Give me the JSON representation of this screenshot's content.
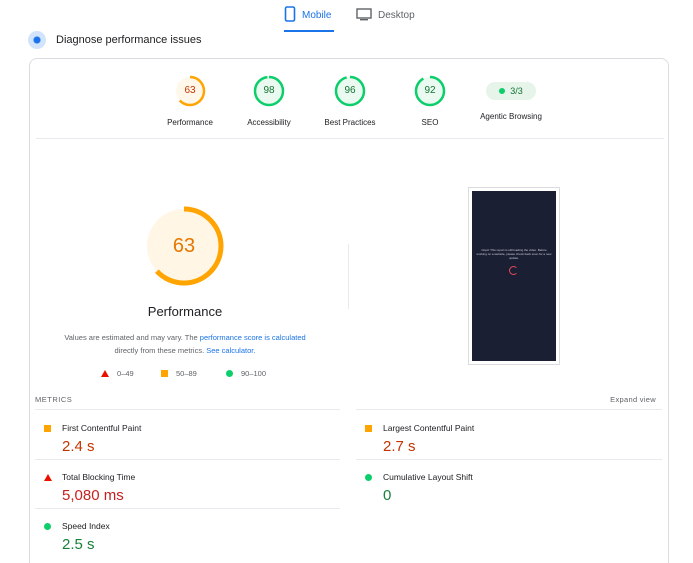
{
  "tabs": [
    {
      "label": "Mobile",
      "active": true
    },
    {
      "label": "Desktop",
      "active": false
    }
  ],
  "header": {
    "title": "Diagnose performance issues"
  },
  "categories": [
    {
      "score": "63",
      "label": "Performance",
      "color": "#ffa400",
      "fraction": 0.63
    },
    {
      "score": "98",
      "label": "Accessibility",
      "color": "#0cce6b",
      "fraction": 0.98
    },
    {
      "score": "96",
      "label": "Best Practices",
      "color": "#0cce6b",
      "fraction": 0.96
    },
    {
      "score": "92",
      "label": "SEO",
      "color": "#0cce6b",
      "fraction": 0.92
    },
    {
      "score": "3/3",
      "label": "Agentic Browsing",
      "pill": true
    }
  ],
  "big": {
    "score": "63",
    "fraction": 0.63,
    "title": "Performance",
    "note_prefix": "Values are estimated and may vary. The ",
    "note_link1": "performance score is calculated",
    "note_middle": "directly from these metrics. ",
    "note_link2": "See calculator."
  },
  "legend": {
    "low": "0–49",
    "mid": "50–89",
    "high": "90–100"
  },
  "screenshot_text": "Oops! This report is still loading the video. Before working on a website, please check back soon for a new update.",
  "metrics_label": "METRICS",
  "expand_label": "Expand view",
  "metrics": [
    {
      "name": "First Contentful Paint",
      "value": "2.4 s",
      "status": "average"
    },
    {
      "name": "Largest Contentful Paint",
      "value": "2.7 s",
      "status": "average"
    },
    {
      "name": "Total Blocking Time",
      "value": "5,080 ms",
      "status": "fail"
    },
    {
      "name": "Cumulative Layout Shift",
      "value": "0",
      "status": "pass"
    },
    {
      "name": "Speed Index",
      "value": "2.5 s",
      "status": "pass"
    }
  ],
  "colors": {
    "accent": "#1a73e8",
    "fail": "#eb0f00",
    "average": "#ffa400",
    "pass": "#0cce6b"
  }
}
